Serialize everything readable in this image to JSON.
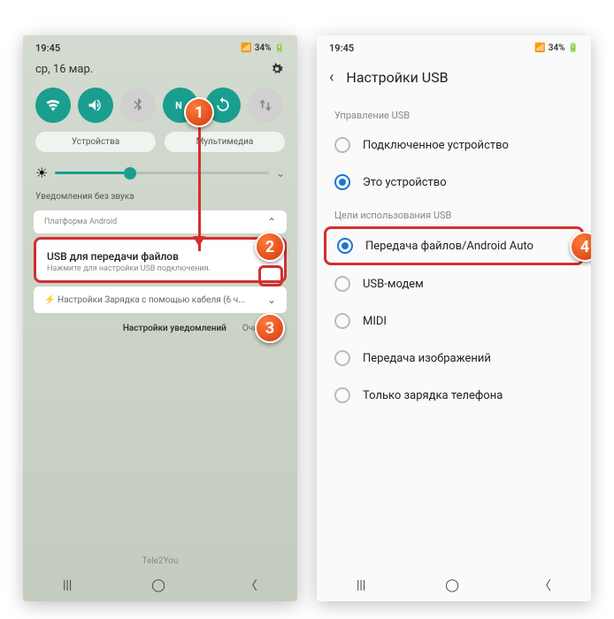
{
  "left": {
    "time": "19:45",
    "battery": "34%",
    "date": "ср, 16 мар.",
    "chip_devices": "Устройства",
    "chip_media": "Мультимедиа",
    "silent": "Уведомления без звука",
    "platform": "Платформа Android",
    "usb_title": "USB для передачи файлов",
    "usb_sub": "Нажмите для настройки USB подключения.",
    "charge": "Настройки  Зарядка с помощью кабеля (6 ч...",
    "footer_settings": "Настройки уведомлений",
    "footer_clear": "Очистить",
    "carrier": "Tele2You"
  },
  "right": {
    "time": "19:45",
    "battery": "34%",
    "title": "Настройки USB",
    "section_control": "Управление USB",
    "opt_connected": "Подключенное устройство",
    "opt_this": "Это устройство",
    "section_purpose": "Цели использования USB",
    "opt_transfer": "Передача файлов/Android Auto",
    "opt_modem": "USB-модем",
    "opt_midi": "MIDI",
    "opt_images": "Передача изображений",
    "opt_charge": "Только зарядка телефона"
  },
  "markers": {
    "m1": "1",
    "m2": "2",
    "m3": "3",
    "m4": "4"
  }
}
